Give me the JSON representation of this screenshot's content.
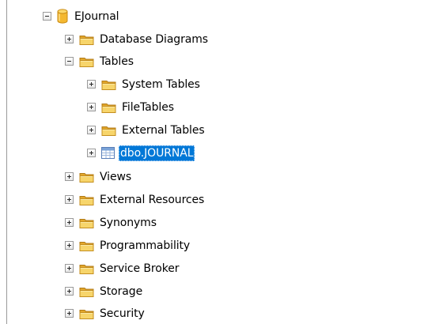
{
  "tree": {
    "root": {
      "label": "EJournal",
      "icon": "database-icon",
      "expanded": true
    },
    "database_diagrams": {
      "label": "Database Diagrams",
      "icon": "folder-icon"
    },
    "tables": {
      "label": "Tables",
      "icon": "folder-icon",
      "expanded": true,
      "system_tables": {
        "label": "System Tables",
        "icon": "folder-icon"
      },
      "file_tables": {
        "label": "FileTables",
        "icon": "folder-icon"
      },
      "external_tables": {
        "label": "External Tables",
        "icon": "folder-icon"
      },
      "journal_table": {
        "label": "dbo.JOURNAL",
        "icon": "table-icon",
        "selected": true
      }
    },
    "views": {
      "label": "Views",
      "icon": "folder-icon"
    },
    "external_resources": {
      "label": "External Resources",
      "icon": "folder-icon"
    },
    "synonyms": {
      "label": "Synonyms",
      "icon": "folder-icon"
    },
    "programmability": {
      "label": "Programmability",
      "icon": "folder-icon"
    },
    "service_broker": {
      "label": "Service Broker",
      "icon": "folder-icon"
    },
    "storage": {
      "label": "Storage",
      "icon": "folder-icon"
    },
    "security": {
      "label": "Security",
      "icon": "folder-icon"
    }
  },
  "colors": {
    "selection": "#0078d7",
    "folder": "#f0c24b",
    "database": "#f2b632",
    "guide_line": "#9a9a9a"
  }
}
